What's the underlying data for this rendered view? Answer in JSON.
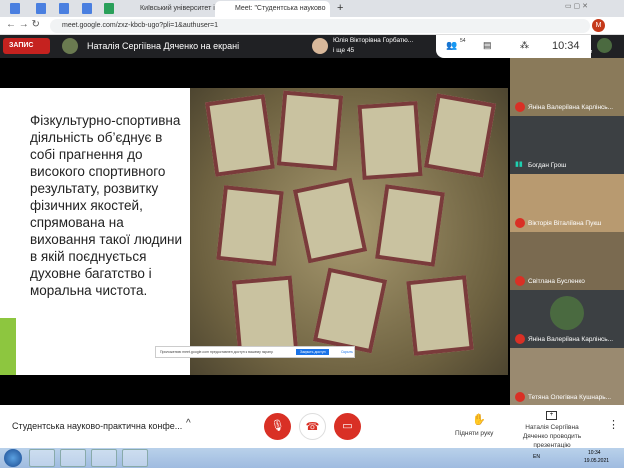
{
  "browser": {
    "tabs": [
      {
        "label": "Київський університет імені Бор"
      },
      {
        "label": "Meet: \"Студентська науково"
      }
    ],
    "url": "meet.google.com/zxz-kbcb-ugo?pli=1&authuser=1",
    "profile_initial": "M"
  },
  "meet": {
    "record_label": "ЗАПИС",
    "presenter_banner": "Наталія Сергіївна Дяченко на екрані",
    "speaker_name": "Юлія Вікторівна Горбатю...",
    "speaker_more": "і ще 45",
    "participants_count": "54",
    "time": "10:34",
    "self_label": "Ви"
  },
  "slide": {
    "text": "Фізкультурно-спортивна діяльність об’єднує в собі прагнення до високого спортивного результату, розвитку фізичних якостей, спрямована на виховання такої людини в якій поєднується духовне багатство і моральна чистота."
  },
  "share_notice": {
    "text": "Приложению meet.google.com предоставлен доступ к вашему экрану.",
    "stop": "Закрыть доступ",
    "hide": "Скрыть"
  },
  "participants": [
    {
      "name": "Яніна Валеріївна Карлінсь...",
      "muted": true
    },
    {
      "name": "Богдан Грош",
      "muted": false
    },
    {
      "name": "Вікторія Віталіївна Пукш",
      "muted": true
    },
    {
      "name": "Світлана Бусленко",
      "muted": true
    },
    {
      "name": "Яніна Валеріївна Карлінсь...",
      "muted": true
    },
    {
      "name": "Тетяна Олегівна Кушнарь...",
      "muted": true
    }
  ],
  "bottom": {
    "meeting_title": "Студентська науково-практична конфе...",
    "raise_hand": "Підняти руку",
    "presenting": "Наталія Сергіївна Дяченко проводить презентацію"
  },
  "taskbar": {
    "lang": "EN",
    "time": "10:34",
    "date": "19.05.2021"
  }
}
